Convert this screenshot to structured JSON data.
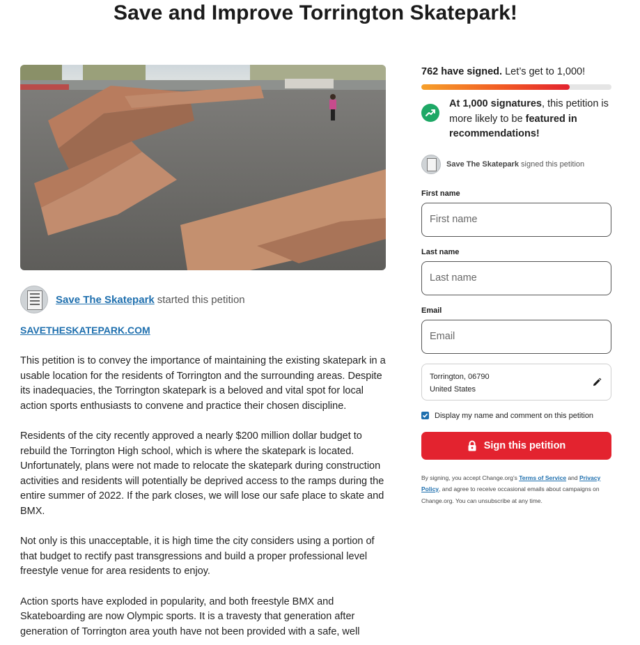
{
  "page": {
    "title": "Save and Improve Torrington Skatepark!"
  },
  "starter": {
    "name": "Save The Skatepark",
    "action": "started this petition"
  },
  "website_link": "SAVETHESKATEPARK.COM",
  "body_paragraphs": [
    "This petition is to convey the importance of maintaining the existing skatepark in a usable location for the residents of Torrington and the surrounding areas. Despite its inadequacies, the Torrington skatepark is a beloved and vital spot for local action sports enthusiasts to convene and practice their chosen discipline.",
    "Residents of the city recently approved a nearly $200 million dollar budget to rebuild the Torrington High school, which is where the skatepark is located. Unfortunately, plans were not made to relocate the skatepark during construction activities and residents will potentially be deprived access to the ramps during the entire summer of 2022. If the park closes, we will lose our safe place to skate and BMX.",
    "Not only is this unacceptable, it is high time the city considers using a portion of that budget to rectify past transgressions and build a proper professional level freestyle venue for area residents to enjoy.",
    "Action sports have exploded in popularity, and both freestyle BMX and Skateboarding are now Olympic sports. It is a travesty that generation after generation of Torrington area youth have not been provided with a safe, well"
  ],
  "signatures": {
    "count_text": "762 have signed.",
    "goal_text": "Let’s get to 1,000!",
    "progress_fraction": 0.78,
    "milestone_bold": "At 1,000 signatures",
    "milestone_mid": ", this petition is more likely to be ",
    "milestone_bold2": "featured in recommendations!"
  },
  "recent_signer": {
    "name": "Save The Skatepark",
    "action": "signed this petition"
  },
  "form": {
    "first_name_label": "First name",
    "first_name_placeholder": "First name",
    "last_name_label": "Last name",
    "last_name_placeholder": "Last name",
    "email_label": "Email",
    "email_placeholder": "Email",
    "location_line1": "Torrington, 06790",
    "location_line2": "United States",
    "display_checkbox_label": "Display my name and comment on this petition",
    "display_checked": true,
    "submit_label": "Sign this petition"
  },
  "disclaimer": {
    "part1": "By signing, you accept Change.org’s ",
    "terms_link": "Terms of Service",
    "part2": " and ",
    "privacy_link": "Privacy Policy",
    "part3": ", and agree to receive occasional emails about campaigns on Change.org. You can unsubscribe at any time."
  },
  "colors": {
    "accent_red": "#e3232f",
    "link_blue": "#1e6fae",
    "trend_green": "#1ea866"
  },
  "icons": [
    "trend-up-icon",
    "pencil-icon",
    "lock-icon",
    "checkmark-icon"
  ]
}
